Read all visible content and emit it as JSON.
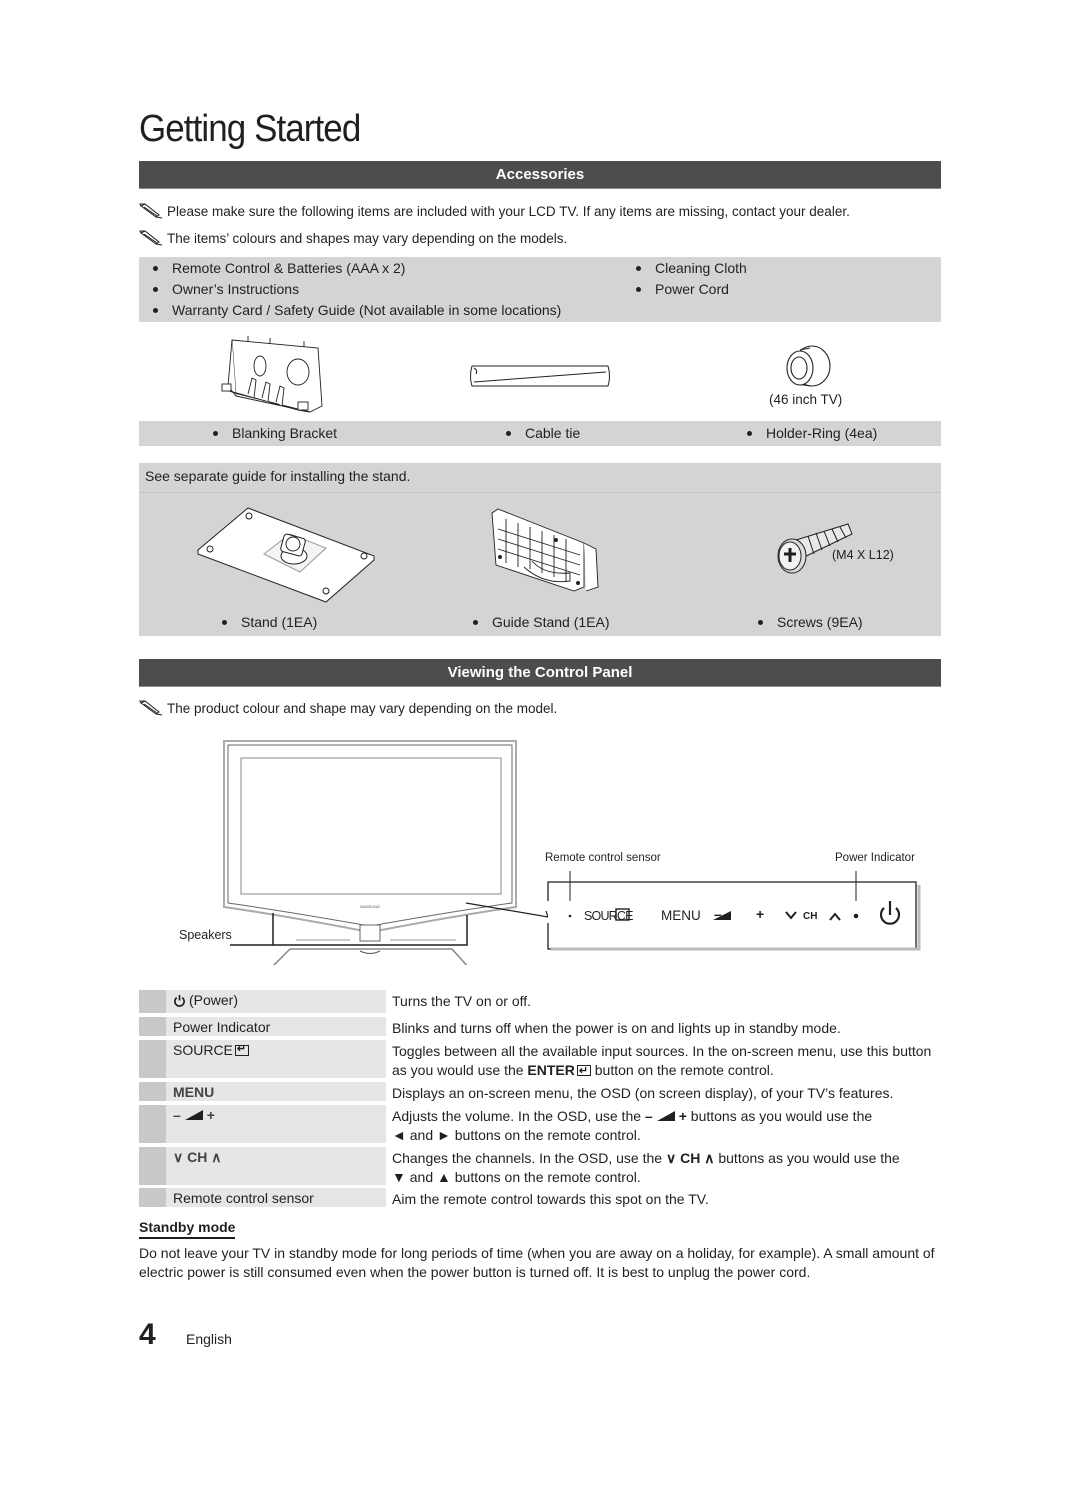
{
  "page": {
    "title": "Getting Started",
    "page_number": "4",
    "language": "English"
  },
  "accessories": {
    "heading": "Accessories",
    "notes": [
      "Please make sure the following items are included with your LCD TV. If any items are missing, contact your dealer.",
      "The items’ colours and shapes may vary depending on the models."
    ],
    "included_items_left": [
      "Remote Control & Batteries (AAA x 2)",
      "Owner’s Instructions",
      "Warranty Card / Safety Guide (Not available in some locations)"
    ],
    "included_items_right": [
      "Cleaning Cloth",
      "Power Cord"
    ],
    "pictured_items": [
      {
        "label": "Blanking Bracket",
        "icon": "blanking-bracket-icon"
      },
      {
        "label": "Cable tie",
        "icon": "cable-tie-icon"
      },
      {
        "label": "Holder-Ring (4ea)",
        "icon": "holder-ring-icon",
        "caption": "(46 inch TV)"
      }
    ],
    "stand_note": "See separate guide for installing the stand.",
    "stand_items": [
      {
        "label": "Stand (1EA)",
        "icon": "stand-icon"
      },
      {
        "label": "Guide Stand (1EA)",
        "icon": "guide-stand-icon"
      },
      {
        "label": "Screws (9EA)",
        "icon": "screw-icon",
        "caption": "(M4 X L12)"
      }
    ]
  },
  "control_panel": {
    "heading": "Viewing the Control Panel",
    "note": "The product colour and shape may vary depending on the model.",
    "diagram": {
      "speakers_label": "Speakers",
      "remote_sensor_label": "Remote control sensor",
      "power_indicator_label": "Power Indicator",
      "brand": "SAMSUNG",
      "panel_source": "SOURCE",
      "panel_menu": "MENU",
      "panel_minus": "–",
      "panel_plus": "+",
      "panel_ch": "CH"
    },
    "rows": [
      {
        "label": "(Power)",
        "desc": "Turns the TV on or off."
      },
      {
        "label": "Power Indicator",
        "desc": "Blinks and turns off when the power is on and lights up in standby mode."
      },
      {
        "label": "SOURCE",
        "desc_part1": "Toggles between all the available input sources. In the on-screen menu, use this button as you would use the ",
        "desc_bold": "ENTER",
        "desc_part2": " button on the remote control."
      },
      {
        "label": "MENU",
        "desc": "Displays an on-screen menu, the OSD (on screen display), of your TV’s features."
      },
      {
        "label_minus": "–",
        "label_plus": "+",
        "desc_part1": "Adjusts the volume. In the OSD, use the ",
        "desc_part2": " buttons as you would use the",
        "desc_line2": "◄ and ► buttons on the remote control."
      },
      {
        "label": "CH",
        "desc_part1": "Changes the channels. In the OSD, use the ",
        "desc_bold": "CH",
        "desc_part2": " buttons as you would use the",
        "desc_line2": "▼ and ▲ buttons on the remote control."
      },
      {
        "label": "Remote control sensor",
        "desc": "Aim the remote control towards this spot on the TV."
      }
    ]
  },
  "standby": {
    "heading": "Standby mode",
    "text": "Do not leave your TV in standby mode for long periods of time (when you are away on a holiday, for example). A small amount of electric power is still consumed even when the power button is turned off. It is best to unplug the power cord."
  }
}
